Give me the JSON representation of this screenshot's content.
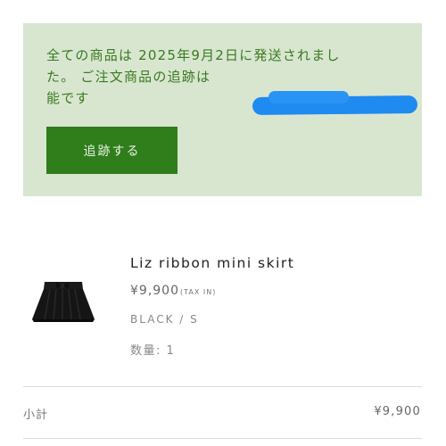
{
  "notice": {
    "line1": "全ての商品は 2025年9月2日に発送されまし",
    "line2": "た。 ご注文商品の追跡は",
    "line3": "能です",
    "track_button_label": "追跡する",
    "redaction_color": "#1f8af0",
    "background_color": "#d8e6d0",
    "text_color": "#3a7a1f",
    "button_color": "#2f7d1b"
  },
  "product": {
    "name": "Liz ribbon mini skirt",
    "price": "¥9,900",
    "tax_note": "(TAX IN)",
    "variant": "BLACK / S",
    "quantity": "数量: 1",
    "image_icon": "skirt-thumbnail"
  },
  "summary": {
    "subtotal_label": "小計",
    "subtotal_value": "¥9,900"
  }
}
